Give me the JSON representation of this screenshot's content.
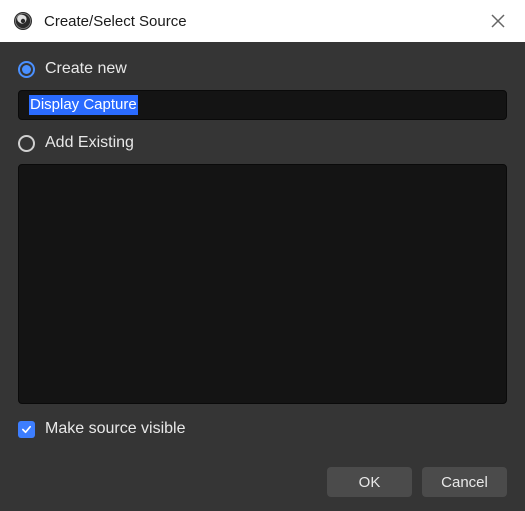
{
  "titlebar": {
    "title": "Create/Select Source"
  },
  "options": {
    "create_new": "Create new",
    "add_existing": "Add Existing"
  },
  "input": {
    "value": "Display Capture"
  },
  "checkbox": {
    "label": "Make source visible",
    "checked": true
  },
  "buttons": {
    "ok": "OK",
    "cancel": "Cancel"
  }
}
